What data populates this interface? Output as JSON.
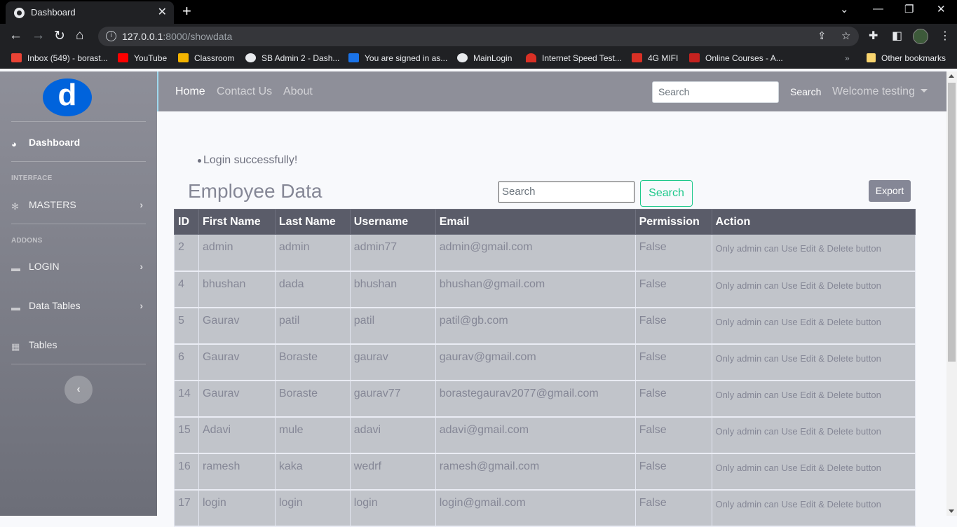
{
  "browser": {
    "tab_title": "Dashboard",
    "url_host": "127.0.0.1",
    "url_rest": ":8000/showdata",
    "bookmarks": [
      {
        "label": "Inbox (549) - borast...",
        "color": "#ea4335"
      },
      {
        "label": "YouTube",
        "color": "#ff0000"
      },
      {
        "label": "Classroom",
        "color": "#f4b400"
      },
      {
        "label": "SB Admin 2 - Dash...",
        "color": "#e8eaed"
      },
      {
        "label": "You are signed in as...",
        "color": "#1a73e8"
      },
      {
        "label": "MainLogin",
        "color": "#e8eaed"
      },
      {
        "label": "Internet Speed Test...",
        "color": "#d93025"
      },
      {
        "label": "4G MIFI",
        "color": "#d93025"
      },
      {
        "label": "Online Courses - A...",
        "color": "#c5221f"
      }
    ],
    "other_bookmarks": "Other bookmarks"
  },
  "sidebar": {
    "logo_letter": "d",
    "dashboard": "Dashboard",
    "interface_heading": "INTERFACE",
    "masters": "MASTERS",
    "addons_heading": "ADDONS",
    "login": "LOGIN",
    "data_tables": "Data Tables",
    "tables": "Tables"
  },
  "topnav": {
    "home": "Home",
    "contact": "Contact Us",
    "about": "About",
    "search_placeholder": "Search",
    "search_button": "Search",
    "welcome": "Welcome testing"
  },
  "content": {
    "message": "Login successfully!",
    "title": "Employee Data",
    "search_placeholder": "Search",
    "search_button": "Search",
    "export_button": "Export",
    "columns": [
      "ID",
      "First Name",
      "Last Name",
      "Username",
      "Email",
      "Permission",
      "Action"
    ],
    "rows": [
      [
        "2",
        "admin",
        "admin",
        "admin77",
        "admin@gmail.com",
        "False",
        "Only admin can Use Edit & Delete button"
      ],
      [
        "4",
        "bhushan",
        "dada",
        "bhushan",
        "bhushan@gmail.com",
        "False",
        "Only admin can Use Edit & Delete button"
      ],
      [
        "5",
        "Gaurav",
        "patil",
        "patil",
        "patil@gb.com",
        "False",
        "Only admin can Use Edit & Delete button"
      ],
      [
        "6",
        "Gaurav",
        "Boraste",
        "gaurav",
        "gaurav@gmail.com",
        "False",
        "Only admin can Use Edit & Delete button"
      ],
      [
        "14",
        "Gaurav",
        "Boraste",
        "gaurav77",
        "borastegaurav2077@gmail.com",
        "False",
        "Only admin can Use Edit & Delete button"
      ],
      [
        "15",
        "Adavi",
        "mule",
        "adavi",
        "adavi@gmail.com",
        "False",
        "Only admin can Use Edit & Delete button"
      ],
      [
        "16",
        "ramesh",
        "kaka",
        "wedrf",
        "ramesh@gmail.com",
        "False",
        "Only admin can Use Edit & Delete button"
      ],
      [
        "17",
        "login",
        "login",
        "login",
        "login@gmail.com",
        "False",
        "Only admin can Use Edit & Delete button"
      ]
    ]
  }
}
